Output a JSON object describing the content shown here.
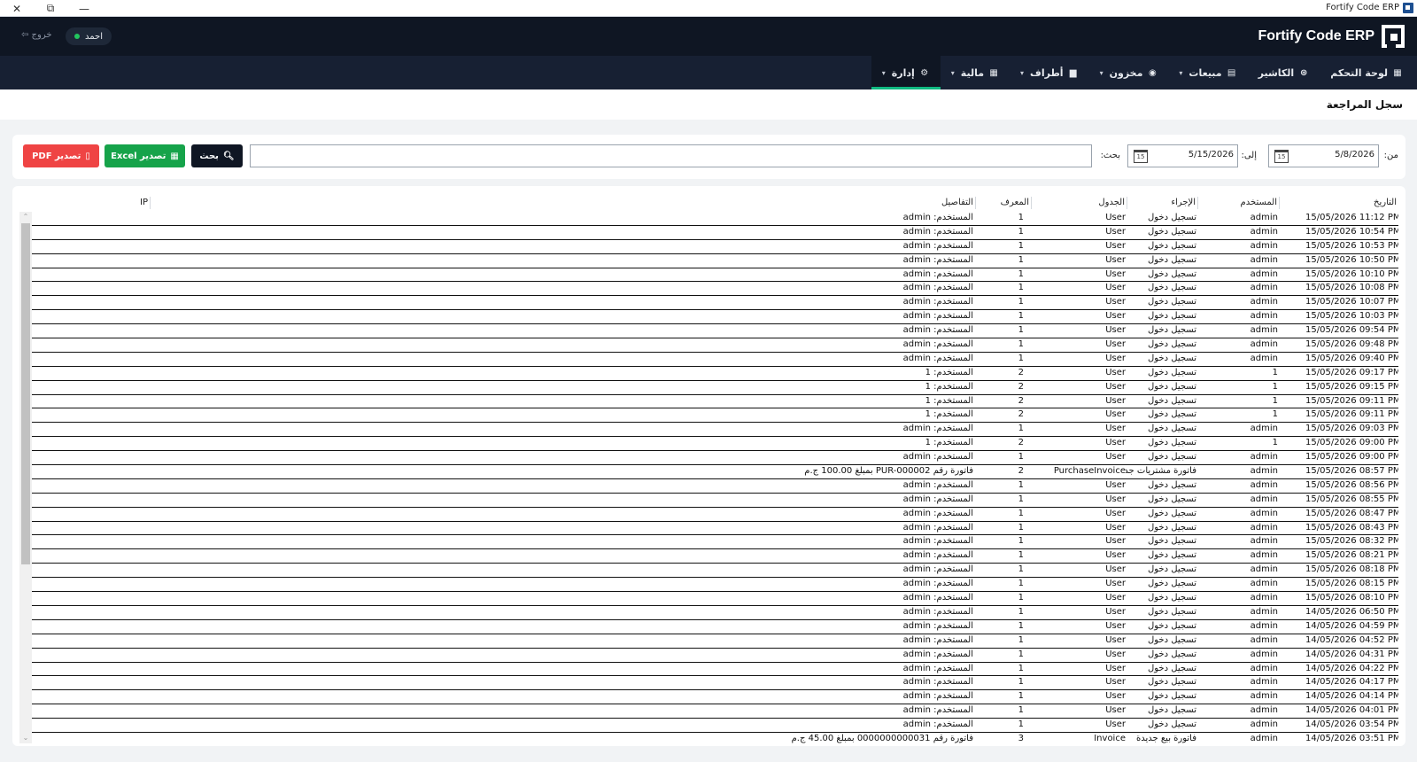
{
  "window": {
    "title": "Fortify Code ERP",
    "close": "✕",
    "restore": "⧉",
    "minimize": "—"
  },
  "header": {
    "brand": "Fortify Code ERP",
    "user_name": "احمد",
    "logout": "خروج ⇦"
  },
  "nav": [
    {
      "label": "لوحة التحكم",
      "icon": "▦",
      "has_menu": false
    },
    {
      "label": "الكاشير",
      "icon": "⊛",
      "has_menu": false
    },
    {
      "label": "مبيعات",
      "icon": "▤",
      "has_menu": true
    },
    {
      "label": "مخزون",
      "icon": "◉",
      "has_menu": true
    },
    {
      "label": "أطراف",
      "icon": "▆",
      "has_menu": true
    },
    {
      "label": "مالية",
      "icon": "▦",
      "has_menu": true
    },
    {
      "label": "إدارة",
      "icon": "⚙",
      "has_menu": true,
      "active": true
    }
  ],
  "page": {
    "title": "سجل المراجعة"
  },
  "filter": {
    "from_label": "من:",
    "from_value": "5/8/2026",
    "to_label": "إلى:",
    "to_value": "5/15/2026",
    "search_label": "بحث:",
    "search_value": "",
    "calendar_glyph": "15",
    "search_button": "بحث",
    "excel_button": "تصدير Excel",
    "pdf_button": "تصدير PDF"
  },
  "table": {
    "columns": [
      "التاريخ",
      "المستخدم",
      "الإجراء",
      "الجدول",
      "المعرف",
      "التفاصيل",
      "IP"
    ],
    "rows": [
      [
        "15/05/2026 11:12 PM",
        "admin",
        "تسجيل دخول",
        "User",
        "1",
        "المستخدم: admin",
        ""
      ],
      [
        "15/05/2026 10:54 PM",
        "admin",
        "تسجيل دخول",
        "User",
        "1",
        "المستخدم: admin",
        ""
      ],
      [
        "15/05/2026 10:53 PM",
        "admin",
        "تسجيل دخول",
        "User",
        "1",
        "المستخدم: admin",
        ""
      ],
      [
        "15/05/2026 10:50 PM",
        "admin",
        "تسجيل دخول",
        "User",
        "1",
        "المستخدم: admin",
        ""
      ],
      [
        "15/05/2026 10:10 PM",
        "admin",
        "تسجيل دخول",
        "User",
        "1",
        "المستخدم: admin",
        ""
      ],
      [
        "15/05/2026 10:08 PM",
        "admin",
        "تسجيل دخول",
        "User",
        "1",
        "المستخدم: admin",
        ""
      ],
      [
        "15/05/2026 10:07 PM",
        "admin",
        "تسجيل دخول",
        "User",
        "1",
        "المستخدم: admin",
        ""
      ],
      [
        "15/05/2026 10:03 PM",
        "admin",
        "تسجيل دخول",
        "User",
        "1",
        "المستخدم: admin",
        ""
      ],
      [
        "15/05/2026 09:54 PM",
        "admin",
        "تسجيل دخول",
        "User",
        "1",
        "المستخدم: admin",
        ""
      ],
      [
        "15/05/2026 09:48 PM",
        "admin",
        "تسجيل دخول",
        "User",
        "1",
        "المستخدم: admin",
        ""
      ],
      [
        "15/05/2026 09:40 PM",
        "admin",
        "تسجيل دخول",
        "User",
        "1",
        "المستخدم: admin",
        ""
      ],
      [
        "15/05/2026 09:17 PM",
        "1",
        "تسجيل دخول",
        "User",
        "2",
        "المستخدم: 1",
        ""
      ],
      [
        "15/05/2026 09:15 PM",
        "1",
        "تسجيل دخول",
        "User",
        "2",
        "المستخدم: 1",
        ""
      ],
      [
        "15/05/2026 09:11 PM",
        "1",
        "تسجيل دخول",
        "User",
        "2",
        "المستخدم: 1",
        ""
      ],
      [
        "15/05/2026 09:11 PM",
        "1",
        "تسجيل دخول",
        "User",
        "2",
        "المستخدم: 1",
        ""
      ],
      [
        "15/05/2026 09:03 PM",
        "admin",
        "تسجيل دخول",
        "User",
        "1",
        "المستخدم: admin",
        ""
      ],
      [
        "15/05/2026 09:00 PM",
        "1",
        "تسجيل دخول",
        "User",
        "2",
        "المستخدم: 1",
        ""
      ],
      [
        "15/05/2026 09:00 PM",
        "admin",
        "تسجيل دخول",
        "User",
        "1",
        "المستخدم: admin",
        ""
      ],
      [
        "15/05/2026 08:57 PM",
        "admin",
        "فاتورة مشتريات جد",
        "PurchaseInvoice",
        "2",
        "فاتورة رقم PUR-000002 بمبلغ 100.00 ج.م",
        ""
      ],
      [
        "15/05/2026 08:56 PM",
        "admin",
        "تسجيل دخول",
        "User",
        "1",
        "المستخدم: admin",
        ""
      ],
      [
        "15/05/2026 08:55 PM",
        "admin",
        "تسجيل دخول",
        "User",
        "1",
        "المستخدم: admin",
        ""
      ],
      [
        "15/05/2026 08:47 PM",
        "admin",
        "تسجيل دخول",
        "User",
        "1",
        "المستخدم: admin",
        ""
      ],
      [
        "15/05/2026 08:43 PM",
        "admin",
        "تسجيل دخول",
        "User",
        "1",
        "المستخدم: admin",
        ""
      ],
      [
        "15/05/2026 08:32 PM",
        "admin",
        "تسجيل دخول",
        "User",
        "1",
        "المستخدم: admin",
        ""
      ],
      [
        "15/05/2026 08:21 PM",
        "admin",
        "تسجيل دخول",
        "User",
        "1",
        "المستخدم: admin",
        ""
      ],
      [
        "15/05/2026 08:18 PM",
        "admin",
        "تسجيل دخول",
        "User",
        "1",
        "المستخدم: admin",
        ""
      ],
      [
        "15/05/2026 08:15 PM",
        "admin",
        "تسجيل دخول",
        "User",
        "1",
        "المستخدم: admin",
        ""
      ],
      [
        "15/05/2026 08:10 PM",
        "admin",
        "تسجيل دخول",
        "User",
        "1",
        "المستخدم: admin",
        ""
      ],
      [
        "14/05/2026 06:50 PM",
        "admin",
        "تسجيل دخول",
        "User",
        "1",
        "المستخدم: admin",
        ""
      ],
      [
        "14/05/2026 04:59 PM",
        "admin",
        "تسجيل دخول",
        "User",
        "1",
        "المستخدم: admin",
        ""
      ],
      [
        "14/05/2026 04:52 PM",
        "admin",
        "تسجيل دخول",
        "User",
        "1",
        "المستخدم: admin",
        ""
      ],
      [
        "14/05/2026 04:31 PM",
        "admin",
        "تسجيل دخول",
        "User",
        "1",
        "المستخدم: admin",
        ""
      ],
      [
        "14/05/2026 04:22 PM",
        "admin",
        "تسجيل دخول",
        "User",
        "1",
        "المستخدم: admin",
        ""
      ],
      [
        "14/05/2026 04:17 PM",
        "admin",
        "تسجيل دخول",
        "User",
        "1",
        "المستخدم: admin",
        ""
      ],
      [
        "14/05/2026 04:14 PM",
        "admin",
        "تسجيل دخول",
        "User",
        "1",
        "المستخدم: admin",
        ""
      ],
      [
        "14/05/2026 04:01 PM",
        "admin",
        "تسجيل دخول",
        "User",
        "1",
        "المستخدم: admin",
        ""
      ],
      [
        "14/05/2026 03:54 PM",
        "admin",
        "تسجيل دخول",
        "User",
        "1",
        "المستخدم: admin",
        ""
      ],
      [
        "14/05/2026 03:51 PM",
        "admin",
        "فاتورة بيع جديدة",
        "Invoice",
        "3",
        "فاتورة رقم 0000000000031 بمبلغ 45.00 ج.م",
        ""
      ]
    ]
  },
  "colors": {
    "header_bg": "#0f1623",
    "nav_bg": "#172033",
    "active_tab": "#10b981",
    "excel": "#16a34a",
    "pdf": "#ef4444",
    "online": "#22c55e"
  }
}
